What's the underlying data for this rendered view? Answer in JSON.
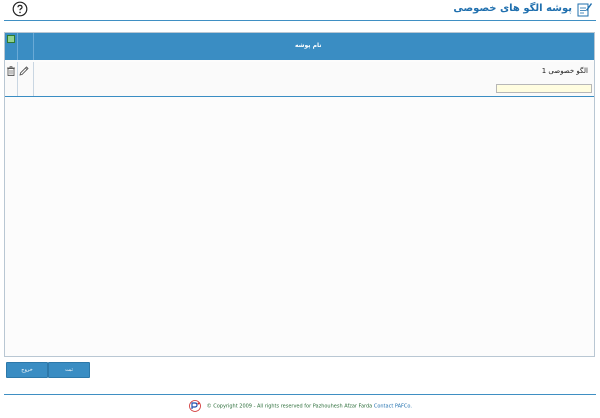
{
  "header": {
    "title": "پوشه الگو های خصوصی"
  },
  "table": {
    "column_header": "نام پوشه",
    "rows": [
      {
        "name": "الگو خصوصی 1"
      }
    ],
    "new_row_value": ""
  },
  "buttons": {
    "exit_label": "خروج",
    "save_label": "ثبت"
  },
  "footer": {
    "copyright": "© Copyright 2009 - All rights reserved for Pazhouhesh Afzar Farda",
    "contact": "Contact PAFCo."
  },
  "colors": {
    "accent": "#3a8dc3",
    "title": "#1f6fae"
  },
  "icons": [
    "help-icon",
    "title-edit-icon",
    "trash-icon",
    "edit-icon",
    "logo-icon"
  ]
}
